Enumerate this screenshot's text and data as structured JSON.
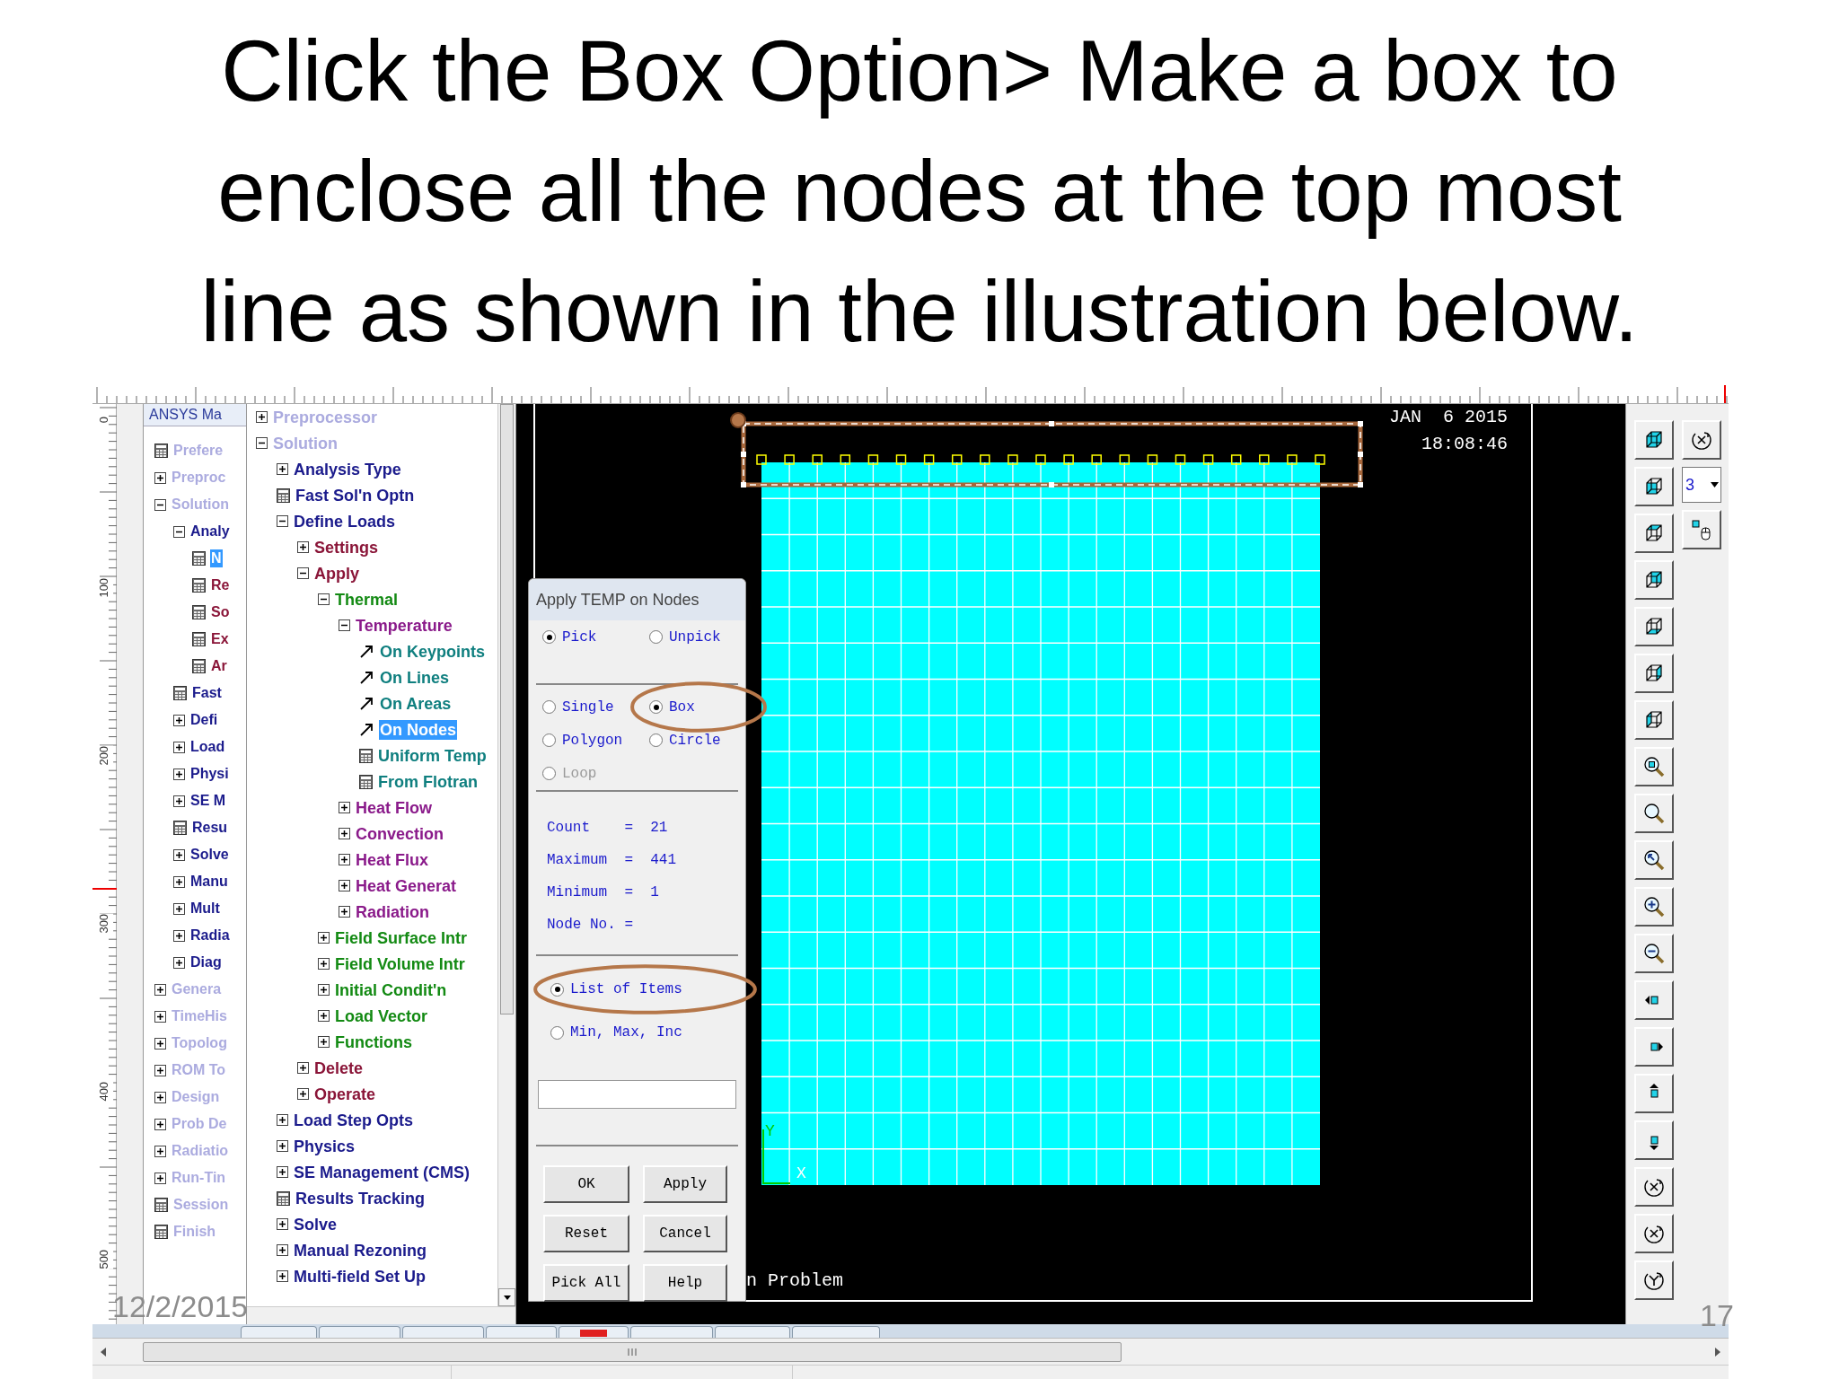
{
  "slide": {
    "title": "Click the  Box Option> Make a box to enclose all the nodes at the top most line as shown in the illustration below.",
    "date": "12/2/2015",
    "page": "17"
  },
  "ansys": {
    "ruler": {
      "labels": [
        "0",
        "100",
        "200",
        "300",
        "400",
        "500"
      ]
    },
    "back_tree": {
      "tab": "ANSYS Ma",
      "items": [
        {
          "label": "Prefere",
          "kind": "leaf",
          "selected": false,
          "disabled": true
        },
        {
          "label": "Preproc",
          "kind": "branch",
          "expanded": false,
          "selected": false,
          "disabled": true
        },
        {
          "label": "Solution",
          "kind": "branch",
          "expanded": true,
          "selected": false,
          "disabled": true,
          "children": [
            {
              "label": "Analy",
              "kind": "branch",
              "expanded": true,
              "selected": false,
              "disabled": false,
              "children": [
                {
                  "label": "N",
                  "kind": "leaf",
                  "selected": true,
                  "disabled": false
                },
                {
                  "label": "Re",
                  "kind": "leaf",
                  "selected": false,
                  "disabled": false
                },
                {
                  "label": "So",
                  "kind": "leaf",
                  "selected": false,
                  "disabled": false
                },
                {
                  "label": "Ex",
                  "kind": "leaf",
                  "selected": false,
                  "disabled": false
                },
                {
                  "label": "Ar",
                  "kind": "leaf",
                  "selected": false,
                  "disabled": false
                }
              ]
            },
            {
              "label": "Fast",
              "kind": "leaf",
              "selected": false,
              "disabled": false
            },
            {
              "label": "Defi",
              "kind": "branch",
              "expanded": false,
              "selected": false,
              "disabled": false
            },
            {
              "label": "Load",
              "kind": "branch",
              "expanded": false,
              "selected": false,
              "disabled": false
            },
            {
              "label": "Physi",
              "kind": "branch",
              "expanded": false,
              "selected": false,
              "disabled": false
            },
            {
              "label": "SE M",
              "kind": "branch",
              "expanded": false,
              "selected": false,
              "disabled": false
            },
            {
              "label": "Resu",
              "kind": "leaf",
              "selected": false,
              "disabled": false
            },
            {
              "label": "Solve",
              "kind": "branch",
              "expanded": false,
              "selected": false,
              "disabled": false
            },
            {
              "label": "Manu",
              "kind": "branch",
              "expanded": false,
              "selected": false,
              "disabled": false
            },
            {
              "label": "Mult",
              "kind": "branch",
              "expanded": false,
              "selected": false,
              "disabled": false
            },
            {
              "label": "Radia",
              "kind": "branch",
              "expanded": false,
              "selected": false,
              "disabled": false
            },
            {
              "label": "Diag",
              "kind": "branch",
              "expanded": false,
              "selected": false,
              "disabled": false
            }
          ]
        },
        {
          "label": "Genera",
          "kind": "branch",
          "expanded": false,
          "selected": false,
          "disabled": true
        },
        {
          "label": "TimeHis",
          "kind": "branch",
          "expanded": false,
          "selected": false,
          "disabled": true
        },
        {
          "label": "Topolog",
          "kind": "branch",
          "expanded": false,
          "selected": false,
          "disabled": true
        },
        {
          "label": "ROM To",
          "kind": "branch",
          "expanded": false,
          "selected": false,
          "disabled": true
        },
        {
          "label": "Design",
          "kind": "branch",
          "expanded": false,
          "selected": false,
          "disabled": true
        },
        {
          "label": "Prob De",
          "kind": "branch",
          "expanded": false,
          "selected": false,
          "disabled": true
        },
        {
          "label": "Radiatio",
          "kind": "branch",
          "expanded": false,
          "selected": false,
          "disabled": true
        },
        {
          "label": "Run-Tin",
          "kind": "branch",
          "expanded": false,
          "selected": false,
          "disabled": true
        },
        {
          "label": "Session",
          "kind": "leaf",
          "selected": false,
          "disabled": true
        },
        {
          "label": "Finish",
          "kind": "leaf",
          "selected": false,
          "disabled": true
        }
      ]
    },
    "tree": {
      "items": [
        {
          "label": "Preprocessor",
          "kind": "branch",
          "expanded": false,
          "selected": false,
          "disabled": true
        },
        {
          "label": "Solution",
          "kind": "branch",
          "expanded": true,
          "selected": false,
          "disabled": true,
          "children": [
            {
              "label": "Analysis Type",
              "kind": "branch",
              "expanded": false,
              "selected": false,
              "disabled": false
            },
            {
              "label": "Fast Sol'n Optn",
              "kind": "leaf",
              "selected": false,
              "disabled": false
            },
            {
              "label": "Define Loads",
              "kind": "branch",
              "expanded": true,
              "selected": false,
              "disabled": false,
              "children": [
                {
                  "label": "Settings",
                  "kind": "branch",
                  "expanded": false,
                  "selected": false,
                  "disabled": false
                },
                {
                  "label": "Apply",
                  "kind": "branch",
                  "expanded": true,
                  "selected": false,
                  "disabled": false,
                  "children": [
                    {
                      "label": "Thermal",
                      "kind": "branch",
                      "expanded": true,
                      "selected": false,
                      "disabled": false,
                      "children": [
                        {
                          "label": "Temperature",
                          "kind": "branch",
                          "expanded": true,
                          "selected": false,
                          "disabled": false,
                          "children": [
                            {
                              "label": "On Keypoints",
                              "kind": "pick",
                              "selected": false,
                              "disabled": false
                            },
                            {
                              "label": "On Lines",
                              "kind": "pick",
                              "selected": false,
                              "disabled": false
                            },
                            {
                              "label": "On Areas",
                              "kind": "pick",
                              "selected": false,
                              "disabled": false
                            },
                            {
                              "label": "On Nodes",
                              "kind": "pick",
                              "selected": true,
                              "disabled": false
                            },
                            {
                              "label": "Uniform Temp",
                              "kind": "leaf",
                              "selected": false,
                              "disabled": false
                            },
                            {
                              "label": "From Flotran",
                              "kind": "leaf",
                              "selected": false,
                              "disabled": false
                            }
                          ]
                        },
                        {
                          "label": "Heat Flow",
                          "kind": "branch",
                          "expanded": false,
                          "selected": false,
                          "disabled": false
                        },
                        {
                          "label": "Convection",
                          "kind": "branch",
                          "expanded": false,
                          "selected": false,
                          "disabled": false
                        },
                        {
                          "label": "Heat Flux",
                          "kind": "branch",
                          "expanded": false,
                          "selected": false,
                          "disabled": false
                        },
                        {
                          "label": "Heat Generat",
                          "kind": "branch",
                          "expanded": false,
                          "selected": false,
                          "disabled": false
                        },
                        {
                          "label": "Radiation",
                          "kind": "branch",
                          "expanded": false,
                          "selected": false,
                          "disabled": false
                        }
                      ]
                    },
                    {
                      "label": "Field Surface Intr",
                      "kind": "branch",
                      "expanded": false,
                      "selected": false,
                      "disabled": false
                    },
                    {
                      "label": "Field Volume Intr",
                      "kind": "branch",
                      "expanded": false,
                      "selected": false,
                      "disabled": false
                    },
                    {
                      "label": "Initial Condit'n",
                      "kind": "branch",
                      "expanded": false,
                      "selected": false,
                      "disabled": false
                    },
                    {
                      "label": "Load Vector",
                      "kind": "branch",
                      "expanded": false,
                      "selected": false,
                      "disabled": false
                    },
                    {
                      "label": "Functions",
                      "kind": "branch",
                      "expanded": false,
                      "selected": false,
                      "disabled": false
                    }
                  ]
                },
                {
                  "label": "Delete",
                  "kind": "branch",
                  "expanded": false,
                  "selected": false,
                  "disabled": false
                },
                {
                  "label": "Operate",
                  "kind": "branch",
                  "expanded": false,
                  "selected": false,
                  "disabled": false
                }
              ]
            },
            {
              "label": "Load Step Opts",
              "kind": "branch",
              "expanded": false,
              "selected": false,
              "disabled": false
            },
            {
              "label": "Physics",
              "kind": "branch",
              "expanded": false,
              "selected": false,
              "disabled": false
            },
            {
              "label": "SE Management (CMS)",
              "kind": "branch",
              "expanded": false,
              "selected": false,
              "disabled": false
            },
            {
              "label": "Results Tracking",
              "kind": "leaf",
              "selected": false,
              "disabled": false
            },
            {
              "label": "Solve",
              "kind": "branch",
              "expanded": false,
              "selected": false,
              "disabled": false
            },
            {
              "label": "Manual Rezoning",
              "kind": "branch",
              "expanded": false,
              "selected": false,
              "disabled": false
            },
            {
              "label": "Multi-field Set Up",
              "kind": "branch",
              "expanded": false,
              "selected": false,
              "disabled": false
            }
          ]
        }
      ]
    },
    "dialog": {
      "title": "Apply TEMP on Nodes",
      "modes": [
        {
          "label": "Pick",
          "selected": true,
          "circled": false
        },
        {
          "label": "Unpick",
          "selected": false,
          "circled": false
        }
      ],
      "shapes": [
        {
          "label": "Single",
          "selected": false,
          "disabled": false,
          "circled": false
        },
        {
          "label": "Box",
          "selected": true,
          "disabled": false,
          "circled": true
        },
        {
          "label": "Polygon",
          "selected": false,
          "disabled": false,
          "circled": false
        },
        {
          "label": "Circle",
          "selected": false,
          "disabled": false,
          "circled": false
        },
        {
          "label": "Loop",
          "selected": false,
          "disabled": true,
          "circled": false
        }
      ],
      "info": [
        "Count    =  21",
        "Maximum  =  441",
        "Minimum  =  1",
        "Node No. ="
      ],
      "entry_modes": [
        {
          "label": "List of Items",
          "selected": true,
          "circled": true
        },
        {
          "label": "Min, Max, Inc",
          "selected": false,
          "circled": false
        }
      ],
      "buttons": [
        "OK",
        "Apply",
        "Reset",
        "Cancel",
        "Pick All",
        "Help"
      ]
    },
    "graphics": {
      "date": "JAN  6 2015",
      "time": "18:08:46",
      "message": "n Problem",
      "axis_labels": [
        "Y",
        "X"
      ]
    },
    "toolbar": {
      "view_field": "3"
    }
  }
}
